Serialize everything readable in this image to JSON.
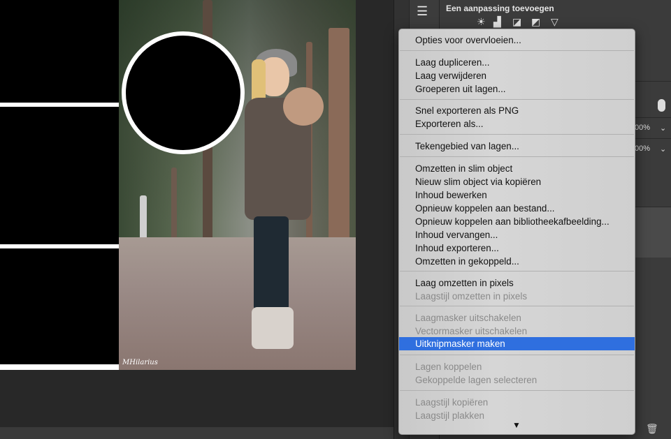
{
  "panel": {
    "title": "Een aanpassing toevoegen",
    "percent_1": "00%",
    "percent_2": "00%"
  },
  "canvas": {
    "watermark": "MHilarius"
  },
  "menu": {
    "items": [
      {
        "label": "Opties voor overvloeien...",
        "enabled": true
      },
      {
        "label": "Laag dupliceren...",
        "enabled": true
      },
      {
        "label": "Laag verwijderen",
        "enabled": true
      },
      {
        "label": "Groeperen uit lagen...",
        "enabled": true
      },
      {
        "label": "Snel exporteren als PNG",
        "enabled": true
      },
      {
        "label": "Exporteren als...",
        "enabled": true
      },
      {
        "label": "Tekengebied van lagen...",
        "enabled": true
      },
      {
        "label": "Omzetten in slim object",
        "enabled": true
      },
      {
        "label": "Nieuw slim object via kopiëren",
        "enabled": true
      },
      {
        "label": "Inhoud bewerken",
        "enabled": true
      },
      {
        "label": "Opnieuw koppelen aan bestand...",
        "enabled": true
      },
      {
        "label": "Opnieuw koppelen aan bibliotheekafbeelding...",
        "enabled": true
      },
      {
        "label": "Inhoud vervangen...",
        "enabled": true
      },
      {
        "label": "Inhoud exporteren...",
        "enabled": true
      },
      {
        "label": "Omzetten in gekoppeld...",
        "enabled": true
      },
      {
        "label": "Laag omzetten in pixels",
        "enabled": true
      },
      {
        "label": "Laagstijl omzetten in pixels",
        "enabled": false
      },
      {
        "label": "Laagmasker uitschakelen",
        "enabled": false
      },
      {
        "label": "Vectormasker uitschakelen",
        "enabled": false
      },
      {
        "label": "Uitknipmasker maken",
        "enabled": true,
        "selected": true
      },
      {
        "label": "Lagen koppelen",
        "enabled": false
      },
      {
        "label": "Gekoppelde lagen selecteren",
        "enabled": false
      },
      {
        "label": "Laagstijl kopiëren",
        "enabled": false
      },
      {
        "label": "Laagstijl plakken",
        "enabled": false
      }
    ],
    "more_indicator": "▼"
  },
  "colors": {
    "selection": "#2f6fdf",
    "menu_bg": "#d0d0d0",
    "disabled_text": "#8a8a8a"
  },
  "icons": [
    "sliders-icon",
    "brightness-icon",
    "levels-icon",
    "curves-icon",
    "exposure-icon",
    "gradient-triangle-icon",
    "trash-icon"
  ]
}
